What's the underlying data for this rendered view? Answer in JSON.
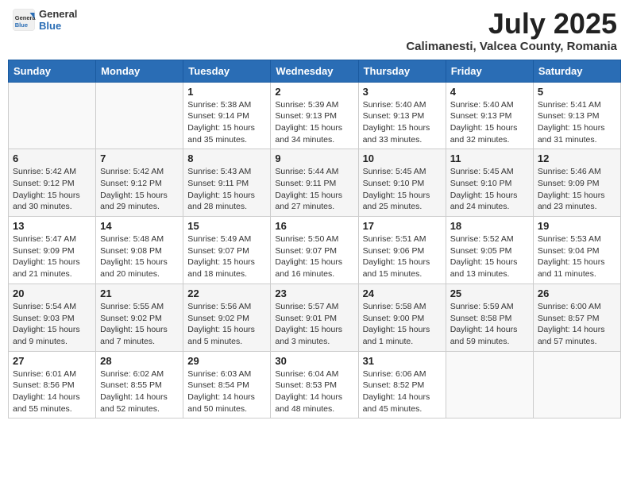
{
  "header": {
    "logo": {
      "general": "General",
      "blue": "Blue"
    },
    "title": "July 2025",
    "location": "Calimanesti, Valcea County, Romania"
  },
  "weekdays": [
    "Sunday",
    "Monday",
    "Tuesday",
    "Wednesday",
    "Thursday",
    "Friday",
    "Saturday"
  ],
  "weeks": [
    [
      {
        "day": "",
        "detail": ""
      },
      {
        "day": "",
        "detail": ""
      },
      {
        "day": "1",
        "detail": "Sunrise: 5:38 AM\nSunset: 9:14 PM\nDaylight: 15 hours\nand 35 minutes."
      },
      {
        "day": "2",
        "detail": "Sunrise: 5:39 AM\nSunset: 9:13 PM\nDaylight: 15 hours\nand 34 minutes."
      },
      {
        "day": "3",
        "detail": "Sunrise: 5:40 AM\nSunset: 9:13 PM\nDaylight: 15 hours\nand 33 minutes."
      },
      {
        "day": "4",
        "detail": "Sunrise: 5:40 AM\nSunset: 9:13 PM\nDaylight: 15 hours\nand 32 minutes."
      },
      {
        "day": "5",
        "detail": "Sunrise: 5:41 AM\nSunset: 9:13 PM\nDaylight: 15 hours\nand 31 minutes."
      }
    ],
    [
      {
        "day": "6",
        "detail": "Sunrise: 5:42 AM\nSunset: 9:12 PM\nDaylight: 15 hours\nand 30 minutes."
      },
      {
        "day": "7",
        "detail": "Sunrise: 5:42 AM\nSunset: 9:12 PM\nDaylight: 15 hours\nand 29 minutes."
      },
      {
        "day": "8",
        "detail": "Sunrise: 5:43 AM\nSunset: 9:11 PM\nDaylight: 15 hours\nand 28 minutes."
      },
      {
        "day": "9",
        "detail": "Sunrise: 5:44 AM\nSunset: 9:11 PM\nDaylight: 15 hours\nand 27 minutes."
      },
      {
        "day": "10",
        "detail": "Sunrise: 5:45 AM\nSunset: 9:10 PM\nDaylight: 15 hours\nand 25 minutes."
      },
      {
        "day": "11",
        "detail": "Sunrise: 5:45 AM\nSunset: 9:10 PM\nDaylight: 15 hours\nand 24 minutes."
      },
      {
        "day": "12",
        "detail": "Sunrise: 5:46 AM\nSunset: 9:09 PM\nDaylight: 15 hours\nand 23 minutes."
      }
    ],
    [
      {
        "day": "13",
        "detail": "Sunrise: 5:47 AM\nSunset: 9:09 PM\nDaylight: 15 hours\nand 21 minutes."
      },
      {
        "day": "14",
        "detail": "Sunrise: 5:48 AM\nSunset: 9:08 PM\nDaylight: 15 hours\nand 20 minutes."
      },
      {
        "day": "15",
        "detail": "Sunrise: 5:49 AM\nSunset: 9:07 PM\nDaylight: 15 hours\nand 18 minutes."
      },
      {
        "day": "16",
        "detail": "Sunrise: 5:50 AM\nSunset: 9:07 PM\nDaylight: 15 hours\nand 16 minutes."
      },
      {
        "day": "17",
        "detail": "Sunrise: 5:51 AM\nSunset: 9:06 PM\nDaylight: 15 hours\nand 15 minutes."
      },
      {
        "day": "18",
        "detail": "Sunrise: 5:52 AM\nSunset: 9:05 PM\nDaylight: 15 hours\nand 13 minutes."
      },
      {
        "day": "19",
        "detail": "Sunrise: 5:53 AM\nSunset: 9:04 PM\nDaylight: 15 hours\nand 11 minutes."
      }
    ],
    [
      {
        "day": "20",
        "detail": "Sunrise: 5:54 AM\nSunset: 9:03 PM\nDaylight: 15 hours\nand 9 minutes."
      },
      {
        "day": "21",
        "detail": "Sunrise: 5:55 AM\nSunset: 9:02 PM\nDaylight: 15 hours\nand 7 minutes."
      },
      {
        "day": "22",
        "detail": "Sunrise: 5:56 AM\nSunset: 9:02 PM\nDaylight: 15 hours\nand 5 minutes."
      },
      {
        "day": "23",
        "detail": "Sunrise: 5:57 AM\nSunset: 9:01 PM\nDaylight: 15 hours\nand 3 minutes."
      },
      {
        "day": "24",
        "detail": "Sunrise: 5:58 AM\nSunset: 9:00 PM\nDaylight: 15 hours\nand 1 minute."
      },
      {
        "day": "25",
        "detail": "Sunrise: 5:59 AM\nSunset: 8:58 PM\nDaylight: 14 hours\nand 59 minutes."
      },
      {
        "day": "26",
        "detail": "Sunrise: 6:00 AM\nSunset: 8:57 PM\nDaylight: 14 hours\nand 57 minutes."
      }
    ],
    [
      {
        "day": "27",
        "detail": "Sunrise: 6:01 AM\nSunset: 8:56 PM\nDaylight: 14 hours\nand 55 minutes."
      },
      {
        "day": "28",
        "detail": "Sunrise: 6:02 AM\nSunset: 8:55 PM\nDaylight: 14 hours\nand 52 minutes."
      },
      {
        "day": "29",
        "detail": "Sunrise: 6:03 AM\nSunset: 8:54 PM\nDaylight: 14 hours\nand 50 minutes."
      },
      {
        "day": "30",
        "detail": "Sunrise: 6:04 AM\nSunset: 8:53 PM\nDaylight: 14 hours\nand 48 minutes."
      },
      {
        "day": "31",
        "detail": "Sunrise: 6:06 AM\nSunset: 8:52 PM\nDaylight: 14 hours\nand 45 minutes."
      },
      {
        "day": "",
        "detail": ""
      },
      {
        "day": "",
        "detail": ""
      }
    ]
  ]
}
